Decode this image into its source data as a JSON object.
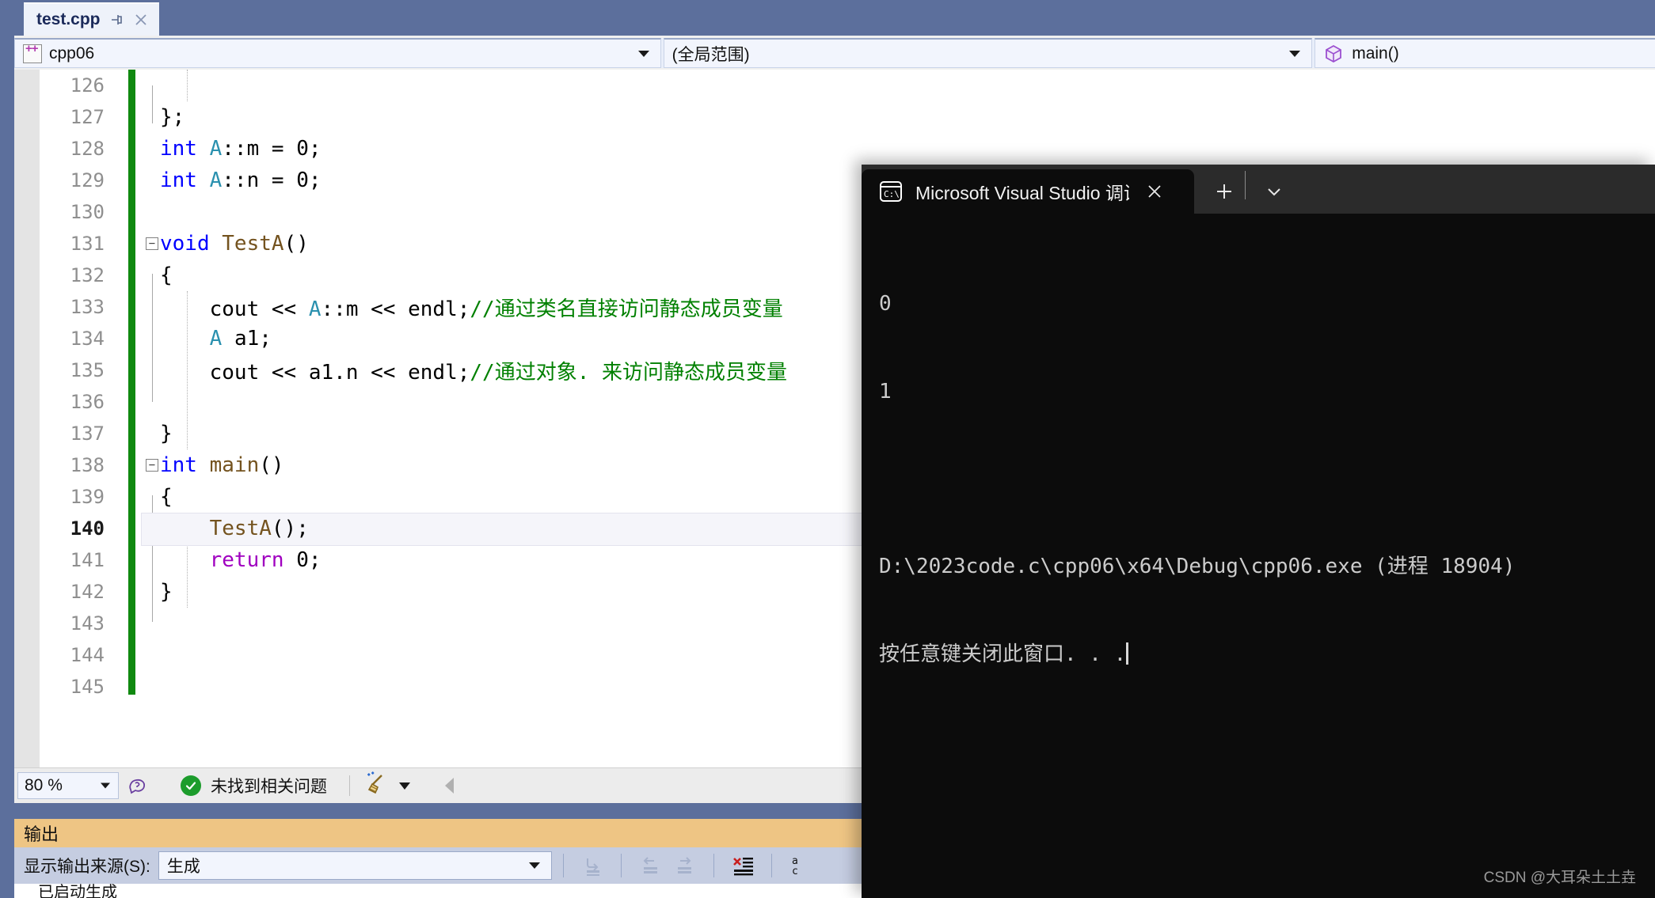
{
  "window": {
    "tab": {
      "filename": "test.cpp",
      "pin_icon": "pin-icon",
      "close_icon": "close-icon"
    }
  },
  "navbar": {
    "project": "cpp06",
    "project_icon": "cpp-file-icon",
    "scope": "(全局范围)",
    "function": "main()",
    "function_icon": "cube-icon",
    "dropdown_icon": "chevron-down-icon"
  },
  "editor": {
    "lines": [
      {
        "num": "126",
        "code": ""
      },
      {
        "num": "127",
        "code": "};"
      },
      {
        "num": "128",
        "code": "int A::m = 0;"
      },
      {
        "num": "129",
        "code": "int A::n = 0;"
      },
      {
        "num": "130",
        "code": ""
      },
      {
        "num": "131",
        "code": "void TestA()"
      },
      {
        "num": "132",
        "code": "{"
      },
      {
        "num": "133",
        "code": "    cout << A::m << endl;//通过类名直接访问静态成员变量"
      },
      {
        "num": "134",
        "code": "    A a1;"
      },
      {
        "num": "135",
        "code": "    cout << a1.n << endl;//通过对象. 来访问静态成员变量"
      },
      {
        "num": "136",
        "code": ""
      },
      {
        "num": "137",
        "code": "}"
      },
      {
        "num": "138",
        "code": "int main()"
      },
      {
        "num": "139",
        "code": "{"
      },
      {
        "num": "140",
        "code": "    TestA();"
      },
      {
        "num": "141",
        "code": "    return 0;"
      },
      {
        "num": "142",
        "code": "}"
      },
      {
        "num": "143",
        "code": ""
      },
      {
        "num": "144",
        "code": ""
      },
      {
        "num": "145",
        "code": ""
      }
    ],
    "active_line": "140",
    "fold_markers": [
      "131",
      "138"
    ],
    "change_bar_color": "#108910"
  },
  "status_bar": {
    "zoom": "80 %",
    "zoom_dropdown_icon": "chevron-down-icon",
    "feedback_icon": "feedback-icon",
    "health_icon": "check-circle-icon",
    "health_text": "未找到相关问题",
    "cleanup_icon": "broom-icon",
    "cleanup_dropdown_icon": "chevron-down-icon",
    "scroll_icon": "triangle-left-icon"
  },
  "output_panel": {
    "title": "输出",
    "source_label": "显示输出来源(S):",
    "source_value": "生成",
    "source_dropdown_icon": "chevron-down-icon",
    "toolbar_icons": [
      "go-to-source-icon",
      "navigate-back-icon",
      "navigate-forward-icon",
      "clear-output-icon",
      "toggle-wordwrap-icon"
    ],
    "first_row": "已启动生成"
  },
  "console": {
    "tab_title": "Microsoft Visual Studio 调试控",
    "tab_icon": "cmd-prompt-icon",
    "tab_close_icon": "close-icon",
    "new_tab_icon": "plus-icon",
    "dropdown_icon": "chevron-down-icon",
    "output": [
      "0",
      "1",
      "",
      "D:\\2023code.c\\cpp06\\x64\\Debug\\cpp06.exe (进程 18904)",
      "按任意键关闭此窗口. . ."
    ]
  },
  "watermark": "CSDN @大耳朵土土垚"
}
